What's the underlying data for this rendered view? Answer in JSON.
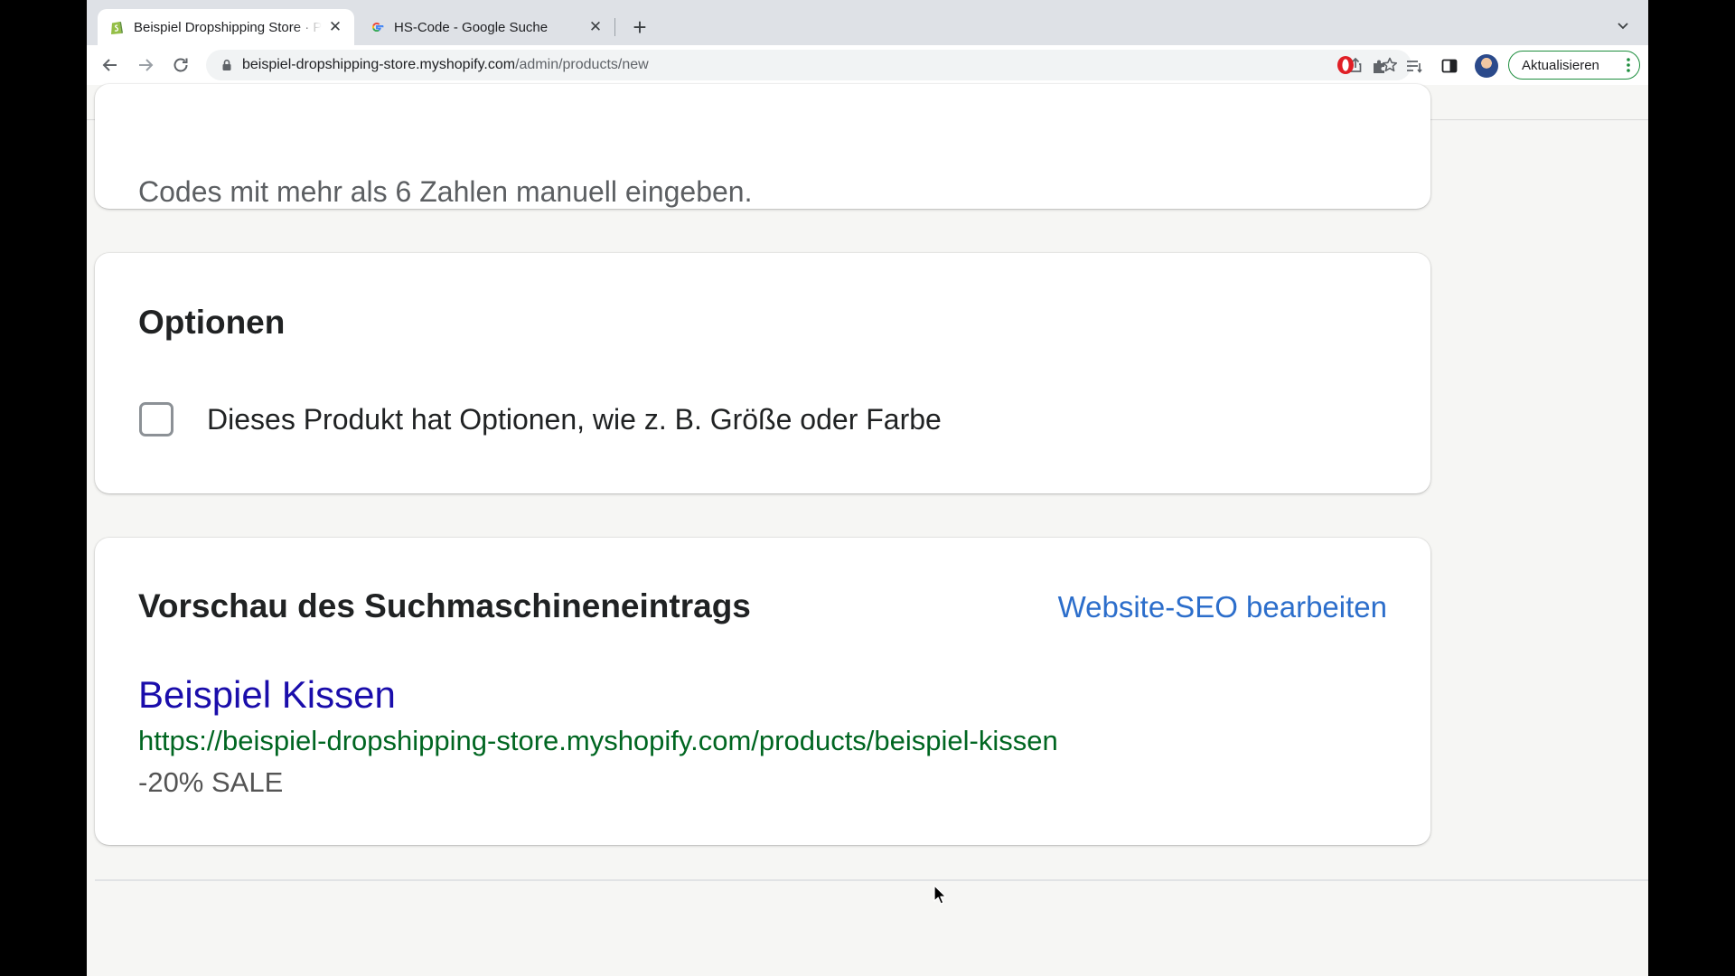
{
  "browser": {
    "tabs": [
      {
        "title": "Beispiel Dropshipping Store · Produkt hinzufügen · Shopify",
        "favicon": "shopify-icon",
        "active": true
      },
      {
        "title": "HS-Code - Google Suche",
        "favicon": "google-icon",
        "active": false
      }
    ],
    "close_glyph": "✕",
    "new_tab_glyph": "+",
    "url": {
      "host": "beispiel-dropshipping-store.myshopify.com",
      "path": "/admin/products/new"
    },
    "update_button_label": "Aktualisieren",
    "accent_color": "#1e8e3e"
  },
  "page": {
    "hs_code_card": {
      "text": "Codes mit mehr als 6 Zahlen manuell eingeben."
    },
    "options_card": {
      "title": "Optionen",
      "checkbox_label": "Dieses Produkt hat Optionen, wie z. B. Größe oder Farbe",
      "checked": false
    },
    "seo_card": {
      "title": "Vorschau des Suchmaschineneintrags",
      "edit_link": "Website-SEO bearbeiten",
      "preview_title": "Beispiel Kissen",
      "preview_url": "https://beispiel-dropshipping-store.myshopify.com/products/beispiel-kissen",
      "preview_description": "-20% SALE"
    }
  },
  "colors": {
    "link": "#2c6ecb",
    "seo_title": "#1a0dab",
    "seo_url": "#006621"
  }
}
